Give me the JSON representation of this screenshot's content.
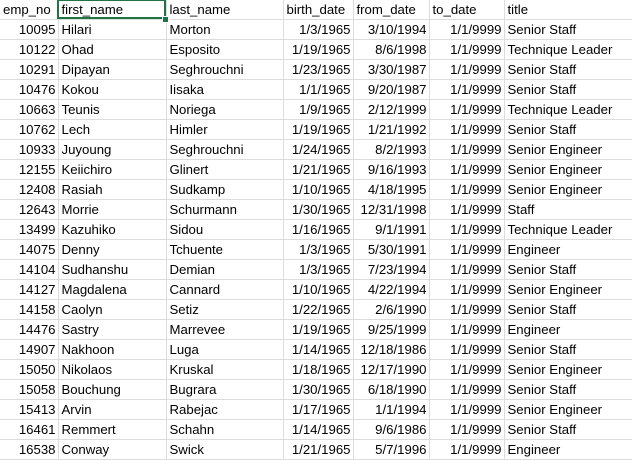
{
  "columns": [
    "emp_no",
    "first_name",
    "last_name",
    "birth_date",
    "from_date",
    "to_date",
    "title"
  ],
  "rows": [
    [
      "10095",
      "Hilari",
      "Morton",
      "1/3/1965",
      "3/10/1994",
      "1/1/9999",
      "Senior Staff"
    ],
    [
      "10122",
      "Ohad",
      "Esposito",
      "1/19/1965",
      "8/6/1998",
      "1/1/9999",
      "Technique Leader"
    ],
    [
      "10291",
      "Dipayan",
      "Seghrouchni",
      "1/23/1965",
      "3/30/1987",
      "1/1/9999",
      "Senior Staff"
    ],
    [
      "10476",
      "Kokou",
      "Iisaka",
      "1/1/1965",
      "9/20/1987",
      "1/1/9999",
      "Senior Staff"
    ],
    [
      "10663",
      "Teunis",
      "Noriega",
      "1/9/1965",
      "2/12/1999",
      "1/1/9999",
      "Technique Leader"
    ],
    [
      "10762",
      "Lech",
      "Himler",
      "1/19/1965",
      "1/21/1992",
      "1/1/9999",
      "Senior Staff"
    ],
    [
      "10933",
      "Juyoung",
      "Seghrouchni",
      "1/24/1965",
      "8/2/1993",
      "1/1/9999",
      "Senior Engineer"
    ],
    [
      "12155",
      "Keiichiro",
      "Glinert",
      "1/21/1965",
      "9/16/1993",
      "1/1/9999",
      "Senior Engineer"
    ],
    [
      "12408",
      "Rasiah",
      "Sudkamp",
      "1/10/1965",
      "4/18/1995",
      "1/1/9999",
      "Senior Engineer"
    ],
    [
      "12643",
      "Morrie",
      "Schurmann",
      "1/30/1965",
      "12/31/1998",
      "1/1/9999",
      "Staff"
    ],
    [
      "13499",
      "Kazuhiko",
      "Sidou",
      "1/16/1965",
      "9/1/1991",
      "1/1/9999",
      "Technique Leader"
    ],
    [
      "14075",
      "Denny",
      "Tchuente",
      "1/3/1965",
      "5/30/1991",
      "1/1/9999",
      "Engineer"
    ],
    [
      "14104",
      "Sudhanshu",
      "Demian",
      "1/3/1965",
      "7/23/1994",
      "1/1/9999",
      "Senior Staff"
    ],
    [
      "14127",
      "Magdalena",
      "Cannard",
      "1/10/1965",
      "4/22/1994",
      "1/1/9999",
      "Senior Engineer"
    ],
    [
      "14158",
      "Caolyn",
      "Setiz",
      "1/22/1965",
      "2/6/1990",
      "1/1/9999",
      "Senior Staff"
    ],
    [
      "14476",
      "Sastry",
      "Marrevee",
      "1/19/1965",
      "9/25/1999",
      "1/1/9999",
      "Engineer"
    ],
    [
      "14907",
      "Nakhoon",
      "Luga",
      "1/14/1965",
      "12/18/1986",
      "1/1/9999",
      "Senior Staff"
    ],
    [
      "15050",
      "Nikolaos",
      "Kruskal",
      "1/18/1965",
      "12/17/1990",
      "1/1/9999",
      "Senior Engineer"
    ],
    [
      "15058",
      "Bouchung",
      "Bugrara",
      "1/30/1965",
      "6/18/1990",
      "1/1/9999",
      "Senior Staff"
    ],
    [
      "15413",
      "Arvin",
      "Rabejac",
      "1/17/1965",
      "1/1/1994",
      "1/1/9999",
      "Senior Engineer"
    ],
    [
      "16461",
      "Remmert",
      "Schahn",
      "1/14/1965",
      "9/6/1986",
      "1/1/9999",
      "Senior Staff"
    ],
    [
      "16538",
      "Conway",
      "Swick",
      "1/21/1965",
      "5/7/1996",
      "1/1/9999",
      "Engineer"
    ]
  ],
  "active_cell": "first_name",
  "colors": {
    "gridline": "#dadcdd",
    "selection": "#217346"
  }
}
